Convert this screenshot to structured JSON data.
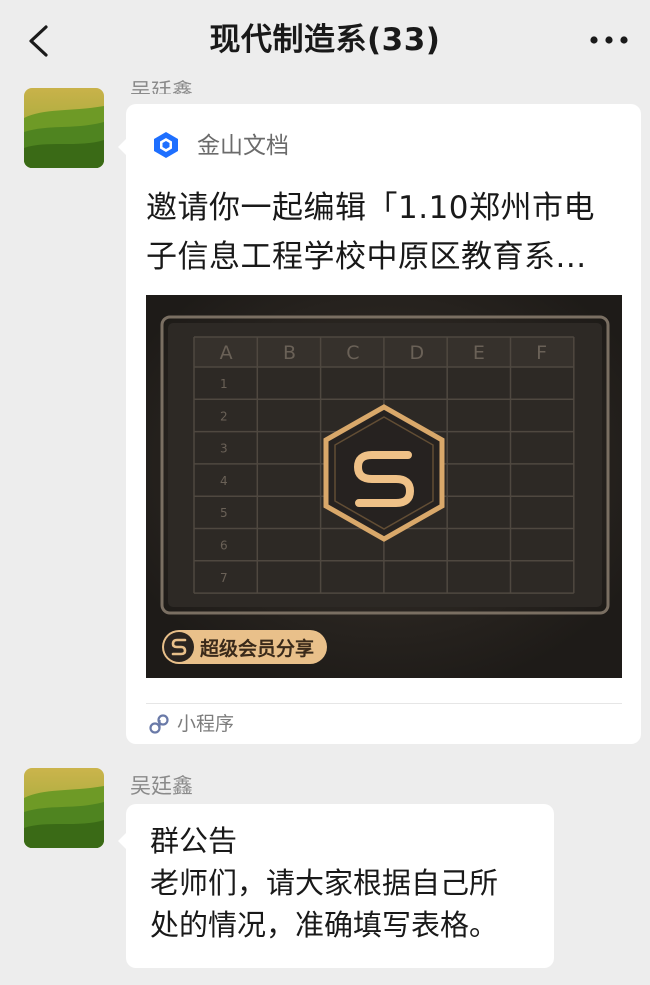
{
  "header": {
    "title": "现代制造系(33)",
    "back_icon": "chevron-left-icon",
    "more_icon": "more-dots-icon"
  },
  "messages": [
    {
      "sender": "吴廷鑫",
      "type": "mini_program_card",
      "card": {
        "source_name": "金山文档",
        "source_icon": "kingsoft-docs-logo-icon",
        "title_lines": [
          "邀请你一起编辑「1.10郑州市电",
          "子信息工程学校中原区教育系..."
        ],
        "preview": {
          "columns": [
            "A",
            "B",
            "C",
            "D",
            "E",
            "F"
          ],
          "rows": [
            "1",
            "2",
            "3",
            "4",
            "5",
            "6",
            "7"
          ],
          "badge_label": "超级会员分享",
          "logo_letter": "S"
        },
        "footer_label": "小程序",
        "footer_icon": "mini-program-icon"
      }
    },
    {
      "sender": "吴廷鑫",
      "type": "text",
      "lines": [
        "群公告",
        "老师们，请大家根据自己所",
        "处的情况，准确填写表格。"
      ]
    }
  ],
  "colors": {
    "background": "#ededed",
    "bubble": "#ffffff",
    "accent_gold": "#e7b97a",
    "preview_dark": "#2a2622"
  }
}
